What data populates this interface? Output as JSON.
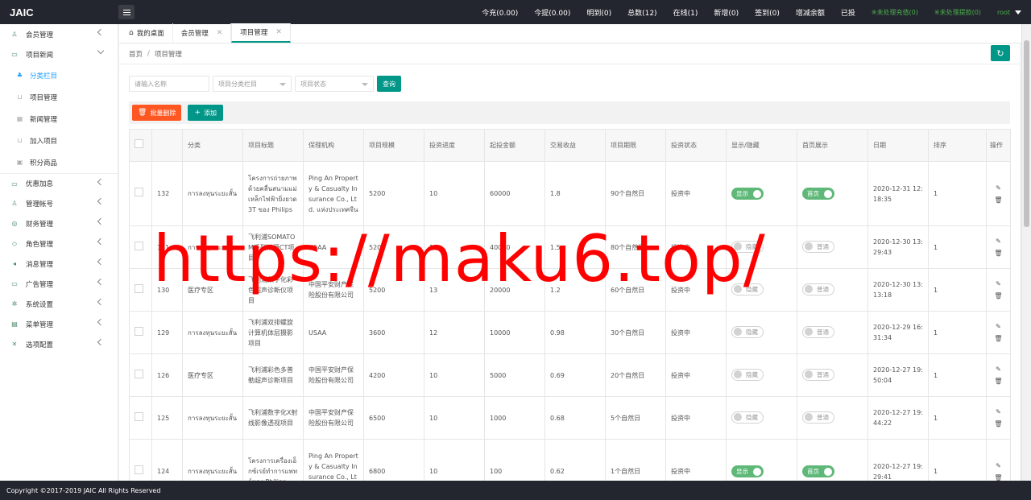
{
  "app": {
    "logo": "JAIC"
  },
  "topbar": {
    "stats": [
      "今充(0.00)",
      "今提(0.00)",
      "明到(0)",
      "总数(12)",
      "在线(1)",
      "新增(0)",
      "签到(0)",
      "增减余额",
      "已投"
    ],
    "pending_recharge": "※未处理充值(0)",
    "pending_withdraw": "※未处理提款(0)",
    "user": "root"
  },
  "sidebar": {
    "items": [
      {
        "label": "会员管理",
        "icon": "user-icon"
      },
      {
        "label": "项目新闻",
        "icon": "book-icon"
      },
      {
        "label": "优惠加息",
        "icon": "card-icon"
      },
      {
        "label": "管理帐号",
        "icon": "user-icon"
      },
      {
        "label": "财务管理",
        "icon": "money-icon"
      },
      {
        "label": "角色管理",
        "icon": "shield-icon"
      },
      {
        "label": "消息管理",
        "icon": "volume-icon"
      },
      {
        "label": "广告管理",
        "icon": "ad-icon"
      },
      {
        "label": "系统设置",
        "icon": "gear-icon"
      },
      {
        "label": "菜单管理",
        "icon": "menu-icon"
      },
      {
        "label": "选项配置",
        "icon": "config-icon"
      }
    ],
    "subitems": [
      "分类栏目",
      "项目管理",
      "新闻管理",
      "加入项目",
      "积分商品"
    ]
  },
  "tabs": {
    "home": "我的桌面",
    "members": "会员管理",
    "projects": "项目管理"
  },
  "breadcrumb": {
    "home": "首页",
    "current": "项目管理"
  },
  "search": {
    "name_placeholder": "请输入名称",
    "category_placeholder": "项目分类栏目",
    "status_placeholder": "项目状态",
    "button": "查询"
  },
  "toolbar": {
    "batch_delete": "批量删除",
    "add": "添加"
  },
  "table": {
    "headers": [
      "分类",
      "项目标题",
      "保理机构",
      "项目规模",
      "投资进度",
      "起投金额",
      "交易收益",
      "项目期限",
      "投资状态",
      "显示/隐藏",
      "首页展示",
      "日期",
      "排序",
      "操作"
    ],
    "rows": [
      {
        "id": "132",
        "category": "การลงทุนระยะสั้น",
        "title": "โครงการถ่ายภาพด้วยคลื่นสนามแม่เหล็กไฟฟ้ายิ่งยวด 3T ของ Philips",
        "org": "Ping An Property & Casualty Insurance Co., Ltd. แห่งประเทศจีน",
        "scale": "5200",
        "progress": "10",
        "min": "60000",
        "yield": "1.8",
        "term": "90个自然日",
        "status": "投资中",
        "show": "显示",
        "home": "首页",
        "date": "2020-12-31 12:18:35",
        "sort": "1"
      },
      {
        "id": "131",
        "category": "การลงทุนระยะสั้น",
        "title": "飞利浦SOMATOM系列双源CT项目",
        "org": "USAA",
        "scale": "5200",
        "progress": "10",
        "min": "40000",
        "yield": "1.5",
        "term": "80个自然日",
        "status": "投资中",
        "show": "隐藏",
        "home": "普通",
        "date": "2020-12-30 13:29:43",
        "sort": "1"
      },
      {
        "id": "130",
        "category": "医疗专区",
        "title": "飞利浦数字化彩色超声诊断仪项目",
        "org": "中国平安财产保险股份有限公司",
        "scale": "5200",
        "progress": "13",
        "min": "20000",
        "yield": "1.2",
        "term": "60个自然日",
        "status": "投资中",
        "show": "隐藏",
        "home": "普通",
        "date": "2020-12-30 13:13:18",
        "sort": "1"
      },
      {
        "id": "129",
        "category": "การลงทุนระยะสั้น",
        "title": "飞利浦双排螺旋计算机体层摄影项目",
        "org": "USAA",
        "scale": "3600",
        "progress": "12",
        "min": "10000",
        "yield": "0.98",
        "term": "30个自然日",
        "status": "投资中",
        "show": "隐藏",
        "home": "普通",
        "date": "2020-12-29 16:31:34",
        "sort": "1"
      },
      {
        "id": "126",
        "category": "医疗专区",
        "title": "飞利浦彩色多普勒超声诊断项目",
        "org": "中国平安财产保险股份有限公司",
        "scale": "4200",
        "progress": "10",
        "min": "5000",
        "yield": "0.69",
        "term": "20个自然日",
        "status": "投资中",
        "show": "隐藏",
        "home": "普通",
        "date": "2020-12-27 19:50:04",
        "sort": "1"
      },
      {
        "id": "125",
        "category": "การลงทุนระยะสั้น",
        "title": "飞利浦数字化X射线影像透视项目",
        "org": "中国平安财产保险股份有限公司",
        "scale": "6500",
        "progress": "10",
        "min": "1000",
        "yield": "0.68",
        "term": "5个自然日",
        "status": "投资中",
        "show": "隐藏",
        "home": "普通",
        "date": "2020-12-27 19:44:22",
        "sort": "1"
      },
      {
        "id": "124",
        "category": "การลงทุนระยะสั้น",
        "title": "โครงการเครื่องเอ็กซ์เรย์ทำการแพทย์ของ Philips",
        "org": "Ping An Property & Casualty Insurance Co., Ltd. แห่งประเทศจีน",
        "scale": "6800",
        "progress": "10",
        "min": "100",
        "yield": "0.62",
        "term": "1个自然日",
        "status": "投资中",
        "show": "显示",
        "home": "首页",
        "date": "2020-12-27 19:29:41",
        "sort": "1"
      }
    ]
  },
  "footer": {
    "copyright": "Copyright ©2017-2019 JAIC All Rights Reserved"
  },
  "watermark": {
    "text": "https://maku6.top/"
  }
}
